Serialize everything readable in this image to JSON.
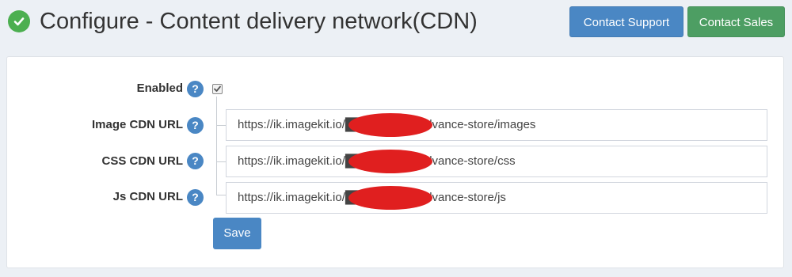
{
  "header": {
    "title": "Configure - Content delivery network(CDN)",
    "contact_support_label": "Contact Support",
    "contact_sales_label": "Contact Sales"
  },
  "form": {
    "enabled": {
      "label": "Enabled",
      "checked": true
    },
    "image_cdn_url": {
      "label": "Image CDN URL",
      "value": "https://ik.imagekit.io/██████/nopadvance-store/images"
    },
    "css_cdn_url": {
      "label": "CSS CDN URL",
      "value": "https://ik.imagekit.io/██████/nopadvance-store/css"
    },
    "js_cdn_url": {
      "label": "Js CDN URL",
      "value": "https://ik.imagekit.io/██████/nopadvance-store/js"
    },
    "help_glyph": "?",
    "save_label": "Save"
  },
  "colors": {
    "primary": "#4a87c4",
    "success": "#4d9e63",
    "title_check": "#4caf50",
    "redaction": "#e01f1f"
  },
  "icons": [
    "check-circle-icon",
    "help-icon",
    "checkbox-checked-icon"
  ]
}
